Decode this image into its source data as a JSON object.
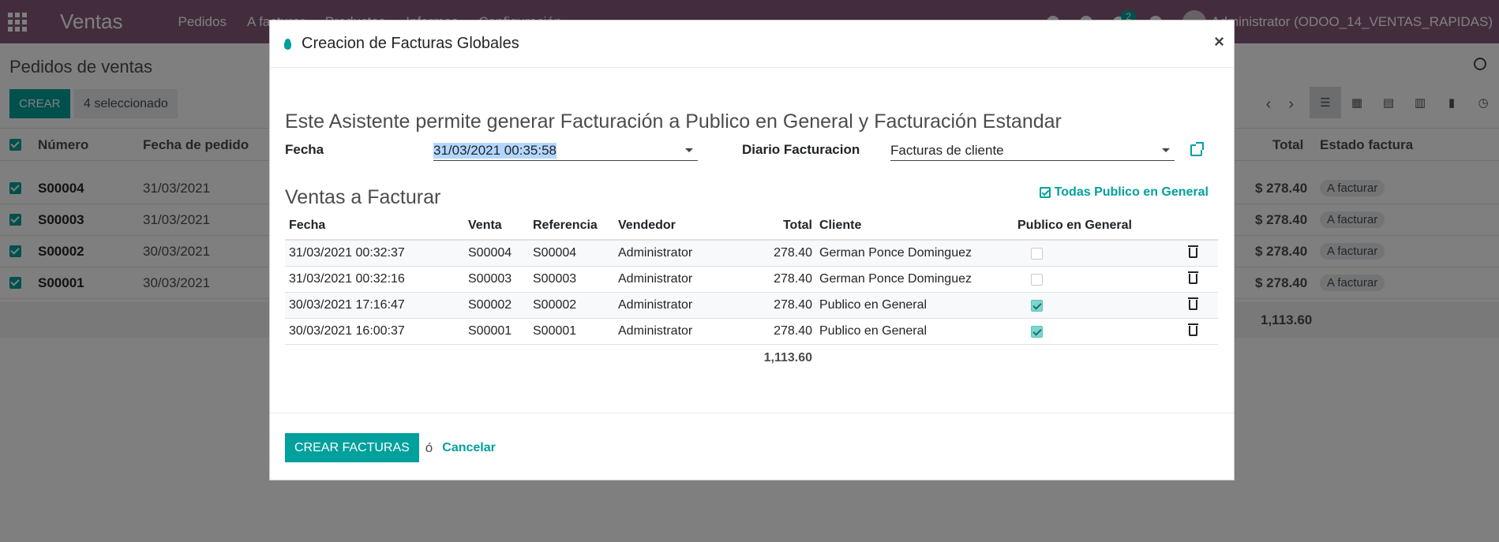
{
  "topbar": {
    "app_title": "Ventas",
    "menu": [
      "Pedidos",
      "A facturar",
      "Productos",
      "Informes",
      "Configuración"
    ],
    "chat_count": "2",
    "user": "Administrator (ODOO_14_VENTAS_RAPIDAS)"
  },
  "control_panel": {
    "breadcrumb": "Pedidos de ventas",
    "create_label": "CREAR",
    "selected_label": "4 seleccionado"
  },
  "bg_list": {
    "headers": {
      "number": "Número",
      "date": "Fecha de pedido",
      "total": "Total",
      "state": "Estado factura"
    },
    "rows": [
      {
        "number": "S00004",
        "date": "31/03/2021",
        "total": "$ 278.40",
        "state": "A facturar"
      },
      {
        "number": "S00003",
        "date": "31/03/2021",
        "total": "$ 278.40",
        "state": "A facturar"
      },
      {
        "number": "S00002",
        "date": "30/03/2021",
        "total": "$ 278.40",
        "state": "A facturar"
      },
      {
        "number": "S00001",
        "date": "30/03/2021",
        "total": "$ 278.40",
        "state": "A facturar"
      }
    ],
    "sum": "1,113.60"
  },
  "modal": {
    "title": "Creacion de Facturas Globales",
    "intro": "Este Asistente permite generar Facturación a Publico en General y Facturación Estandar",
    "fecha_label": "Fecha",
    "fecha_value": "31/03/2021 00:35:58",
    "diario_label": "Diario Facturacion",
    "diario_value": "Facturas de cliente",
    "section_title": "Ventas a Facturar",
    "todas_label": "Todas Publico en General",
    "columns": {
      "fecha": "Fecha",
      "venta": "Venta",
      "referencia": "Referencia",
      "vendedor": "Vendedor",
      "total": "Total",
      "cliente": "Cliente",
      "publico": "Publico en General"
    },
    "rows": [
      {
        "fecha": "31/03/2021 00:32:37",
        "venta": "S00004",
        "referencia": "S00004",
        "vendedor": "Administrator",
        "total": "278.40",
        "cliente": "German Ponce Dominguez",
        "publico": false
      },
      {
        "fecha": "31/03/2021 00:32:16",
        "venta": "S00003",
        "referencia": "S00003",
        "vendedor": "Administrator",
        "total": "278.40",
        "cliente": "German Ponce Dominguez",
        "publico": false
      },
      {
        "fecha": "30/03/2021 17:16:47",
        "venta": "S00002",
        "referencia": "S00002",
        "vendedor": "Administrator",
        "total": "278.40",
        "cliente": "Publico en General",
        "publico": true
      },
      {
        "fecha": "30/03/2021 16:00:37",
        "venta": "S00001",
        "referencia": "S00001",
        "vendedor": "Administrator",
        "total": "278.40",
        "cliente": "Publico en General",
        "publico": true
      }
    ],
    "sum_total": "1,113.60",
    "create_button": "CREAR FACTURAS",
    "or_text": "ó",
    "cancel_link": "Cancelar"
  },
  "colors": {
    "brand": "#875a7b",
    "primary": "#00a09d"
  }
}
